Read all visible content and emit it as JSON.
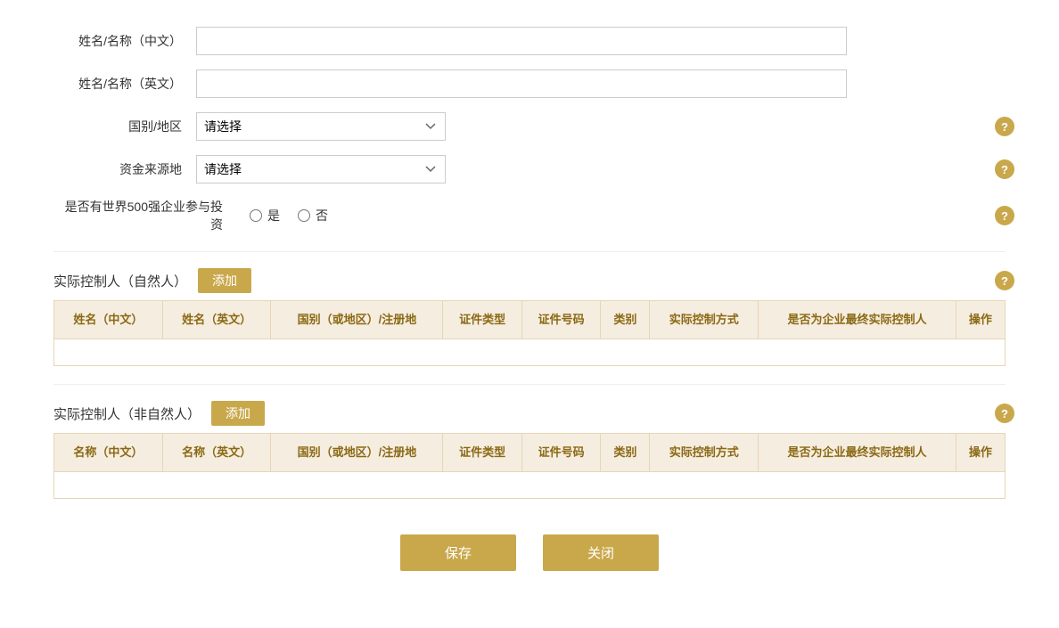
{
  "form": {
    "name_cn_label": "姓名/名称（中文）",
    "name_en_label": "姓名/名称（英文）",
    "country_label": "国别/地区",
    "fund_source_label": "资金来源地",
    "fortune500_label": "是否有世界500强企业参与投资",
    "country_placeholder": "请选择",
    "fund_source_placeholder": "请选择",
    "radio_yes": "是",
    "radio_no": "否",
    "name_cn_value": "",
    "name_en_value": ""
  },
  "natural_person_section": {
    "title": "实际控制人（自然人）",
    "add_label": "添加",
    "help_icon": "?",
    "columns": [
      "姓名（中文）",
      "姓名（英文）",
      "国别（或地区）/注册地",
      "证件类型",
      "证件号码",
      "类别",
      "实际控制方式",
      "是否为企业最终实际控制人",
      "操作"
    ]
  },
  "non_natural_person_section": {
    "title": "实际控制人（非自然人）",
    "add_label": "添加",
    "help_icon": "?",
    "columns": [
      "名称（中文）",
      "名称（英文）",
      "国别（或地区）/注册地",
      "证件类型",
      "证件号码",
      "类别",
      "实际控制方式",
      "是否为企业最终实际控制人",
      "操作"
    ]
  },
  "buttons": {
    "save": "保存",
    "close": "关闭"
  }
}
